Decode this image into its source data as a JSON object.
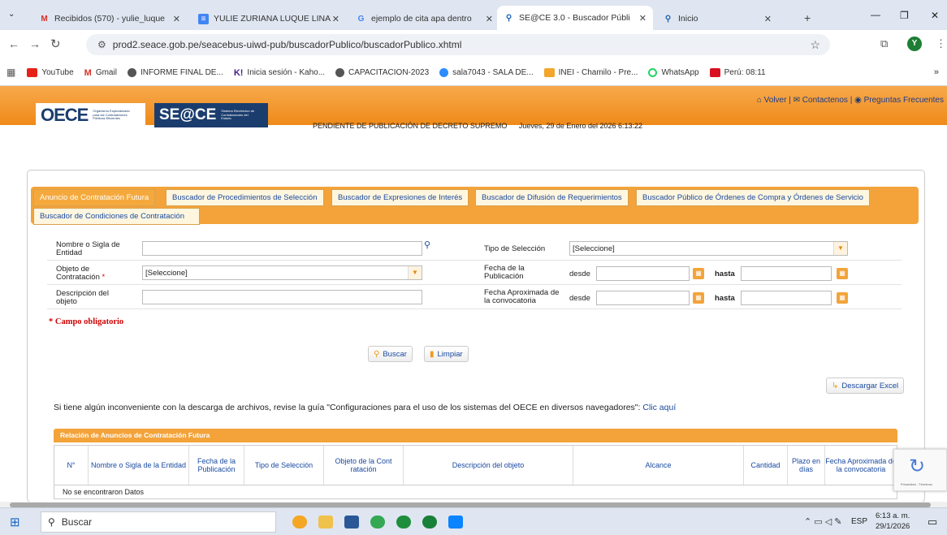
{
  "browser": {
    "tabs": [
      {
        "icon": "gmail-icon",
        "label": "Recibidos (570) - yulie_luque"
      },
      {
        "icon": "docs-icon",
        "label": "YULIE ZURIANA LUQUE LINA"
      },
      {
        "icon": "google-icon",
        "label": "ejemplo de cita apa dentro"
      },
      {
        "icon": "seace-icon",
        "label": "SE@CE 3.0 - Buscador Públi"
      },
      {
        "icon": "seace-icon",
        "label": "Inicio"
      }
    ],
    "url": "prod2.seace.gob.pe/seacebus-uiwd-pub/buscadorPublico/buscadorPublico.xhtml",
    "profile_initial": "Y",
    "bookmarks": [
      {
        "icon": "youtube-icon",
        "label": "YouTube"
      },
      {
        "icon": "gmail-icon",
        "label": "Gmail"
      },
      {
        "icon": "globe-icon",
        "label": "INFORME FINAL DE..."
      },
      {
        "icon": "kahoot-icon",
        "label": "Inicia sesión - Kaho..."
      },
      {
        "icon": "globe-icon",
        "label": "CAPACITACION-2023"
      },
      {
        "icon": "zoom-icon",
        "label": "sala7043 - SALA DE..."
      },
      {
        "icon": "inei-icon",
        "label": "INEI - Chamilo - Pre..."
      },
      {
        "icon": "whatsapp-icon",
        "label": "WhatsApp"
      },
      {
        "icon": "peru-icon",
        "label": "Perú: 08:11"
      }
    ]
  },
  "site": {
    "logo_oece": "OECE",
    "logo_oece_sub": "Organismo Especializado para las Contrataciones Públicas Eficientes",
    "logo_seace": "SE@CE",
    "logo_seace_sub": "Sistema Electrónico de Contrataciones del Estado",
    "links": {
      "volver": "Volver",
      "contactenos": "Contactenos",
      "preguntas": "Preguntas Frecuentes"
    },
    "status_notice": "PENDIENTE DE PUBLICACIÓN DE DECRETO SUPREMO",
    "datetime": "Jueves, 29 de Enero del 2026 6:13:22"
  },
  "tabs": [
    "Anuncio de Contratación Futura",
    "Buscador de Procedimientos de Selección",
    "Buscador de Expresiones de Interés",
    "Buscador de Difusión de Requerimientos",
    "Buscador Público de Órdenes de Compra y Órdenes de Servicio",
    "Buscador de Condiciones de Contratación"
  ],
  "form": {
    "entidad_label": "Nombre o Sigla de Entidad",
    "objeto_label": "Objeto de Contratación",
    "required_mark": "*",
    "objeto_value": "[Seleccione]",
    "descripcion_label": "Descripción del objeto",
    "tipo_label": "Tipo de Selección",
    "tipo_value": "[Seleccione]",
    "fecha_pub_label": "Fecha de la Publicación",
    "fecha_aprox_label": "Fecha Aproximada de la convocatoria",
    "desde": "desde",
    "hasta": "hasta",
    "campo_obligatorio": "* Campo obligatorio",
    "buscar": "Buscar",
    "limpiar": "Limpiar",
    "descargar": "Descargar Excel"
  },
  "notice": {
    "text": "Si tiene algún inconveniente con la descarga de archivos, revise la guía \"Configuraciones para el uso de los sistemas del OECE en diversos navegadores\":",
    "link": "Clic aquí"
  },
  "table": {
    "title": "Relación de Anuncios de Contratación Futura",
    "columns": [
      "N°",
      "Nombre o Sigla de la Entidad",
      "Fecha de la Publicación",
      "Tipo de Selección",
      "Objeto de la Cont ratación",
      "Descripción del objeto",
      "Alcance",
      "Cantidad",
      "Plazo en días",
      "Fecha Aproximada de la convocatoria"
    ],
    "empty": "No se encontraron Datos"
  },
  "recaptcha": {
    "footer": "Privacidad - Términos"
  },
  "taskbar": {
    "search": "Buscar",
    "lang": "ESP",
    "time": "6:13 a. m.",
    "date": "29/1/2026"
  }
}
